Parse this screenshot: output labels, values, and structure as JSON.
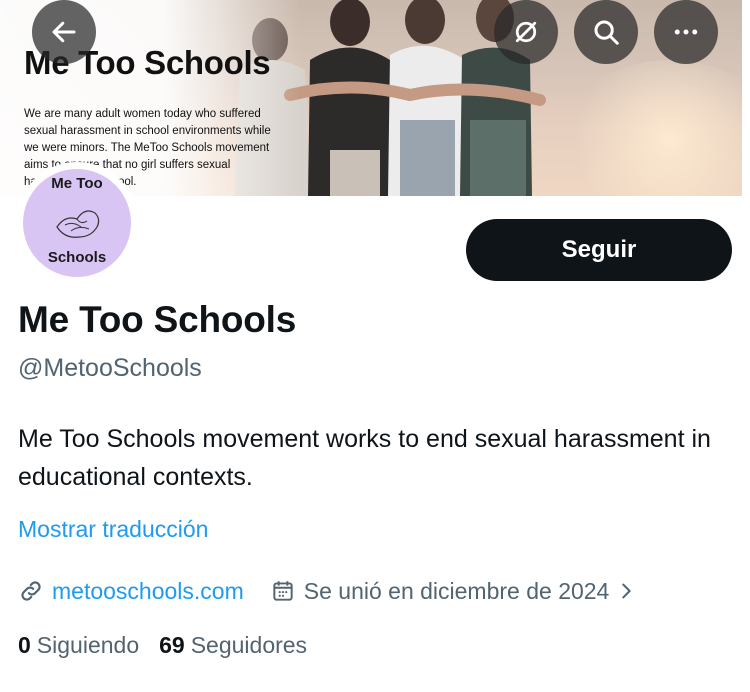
{
  "banner": {
    "title": "Me Too Schools",
    "text": "We are many adult women today who suffered sexual harassment in school environments while we were minors. The MeToo Schools movement aims to ensure that no girl suffers sexual harassment at school."
  },
  "top_buttons": {
    "back_icon": "arrow-left-icon",
    "grok_icon": "grok-icon",
    "search_icon": "search-icon",
    "more_icon": "more-icon"
  },
  "avatar": {
    "line1": "Me Too",
    "line2": "Schools",
    "color": "#d9c5f3"
  },
  "follow_button": {
    "label": "Seguir"
  },
  "profile": {
    "name": "Me Too Schools",
    "handle": "@MetooSchools",
    "bio": "Me Too Schools movement works to end sexual harassment in educational contexts.",
    "translate_label": "Mostrar traducción",
    "website": "metooschools.com",
    "joined": "Se unió en diciembre de 2024"
  },
  "counts": {
    "following_num": "0",
    "following_label": "Siguiendo",
    "followers_num": "69",
    "followers_label": "Seguidores"
  },
  "colors": {
    "accent": "#1d9bf0",
    "text": "#0f1419",
    "muted": "#536471"
  }
}
